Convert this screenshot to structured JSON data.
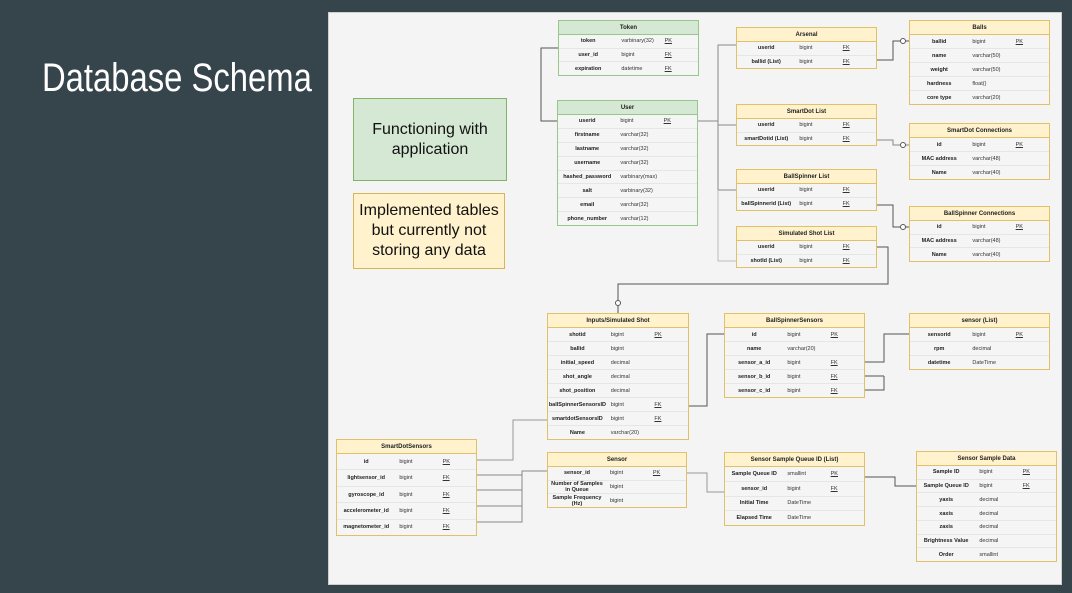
{
  "slide": {
    "title": "Database Schema"
  },
  "legend": {
    "green": "Functioning with application",
    "yellow": "Implemented tables but currently not storing any data"
  },
  "colors": {
    "background": "#36454c",
    "panel": "#f4f4f4",
    "green_fill": "#d5e8d4",
    "green_border": "#82b366",
    "yellow_fill": "#fff2cc",
    "yellow_border": "#d6b656"
  },
  "tables": [
    {
      "name": "Token",
      "status": "functioning",
      "rows": [
        [
          "token",
          "varbinary(32)",
          "PK"
        ],
        [
          "user_id",
          "bigint",
          "FK"
        ],
        [
          "expiration",
          "datetime",
          "FK"
        ]
      ]
    },
    {
      "name": "User",
      "status": "functioning",
      "rows": [
        [
          "userid",
          "bigint",
          "PK"
        ],
        [
          "firstname",
          "varchar(32)",
          ""
        ],
        [
          "lastname",
          "varchar(32)",
          ""
        ],
        [
          "username",
          "varchar(32)",
          ""
        ],
        [
          "hashed_password",
          "varbinary(max)",
          ""
        ],
        [
          "salt",
          "varbinary(32)",
          ""
        ],
        [
          "email",
          "varchar(32)",
          ""
        ],
        [
          "phone_number",
          "varchar(12)",
          ""
        ]
      ]
    },
    {
      "name": "Arsenal",
      "status": "implemented",
      "rows": [
        [
          "userid",
          "bigint",
          "FK"
        ],
        [
          "ballid (List)",
          "bigint",
          "FK"
        ]
      ]
    },
    {
      "name": "SmartDot List",
      "status": "implemented",
      "rows": [
        [
          "userid",
          "bigint",
          "FK"
        ],
        [
          "smartDotid (List)",
          "bigint",
          "FK"
        ]
      ]
    },
    {
      "name": "BallSpinner List",
      "status": "implemented",
      "rows": [
        [
          "userid",
          "bigint",
          "FK"
        ],
        [
          "ballSpinnerid (List)",
          "bigint",
          "FK"
        ]
      ]
    },
    {
      "name": "Simulated Shot List",
      "status": "implemented",
      "rows": [
        [
          "userid",
          "bigint",
          "FK"
        ],
        [
          "shotId (List)",
          "bigint",
          "FK"
        ]
      ]
    },
    {
      "name": "Balls",
      "status": "implemented",
      "rows": [
        [
          "ballid",
          "bigint",
          "PK"
        ],
        [
          "name",
          "varchar(50)",
          ""
        ],
        [
          "weight",
          "varchar(50)",
          ""
        ],
        [
          "hardness",
          "float()",
          ""
        ],
        [
          "core type",
          "varchar(20)",
          ""
        ]
      ]
    },
    {
      "name": "SmartDot Connections",
      "status": "implemented",
      "rows": [
        [
          "id",
          "bigint",
          "PK"
        ],
        [
          "MAC address",
          "varchar(48)",
          ""
        ],
        [
          "Name",
          "varchar(40)",
          ""
        ]
      ]
    },
    {
      "name": "BallSpinner Connections",
      "status": "implemented",
      "rows": [
        [
          "id",
          "bigint",
          "PK"
        ],
        [
          "MAC address",
          "varchar(48)",
          ""
        ],
        [
          "Name",
          "varchar(40)",
          ""
        ]
      ]
    },
    {
      "name": "Inputs/Simulated Shot",
      "status": "implemented",
      "rows": [
        [
          "shotid",
          "bigint",
          "PK"
        ],
        [
          "ballid",
          "bigint",
          ""
        ],
        [
          "initial_speed",
          "decimal",
          ""
        ],
        [
          "shot_angle",
          "decimal",
          ""
        ],
        [
          "shot_position",
          "decimal",
          ""
        ],
        [
          "ballSpinnerSensorsID",
          "bigint",
          "FK"
        ],
        [
          "smartdotSensorsID",
          "bigint",
          "FK"
        ],
        [
          "Name",
          "varchar(20)",
          ""
        ]
      ]
    },
    {
      "name": "BallSpinnerSensors",
      "status": "implemented",
      "rows": [
        [
          "id",
          "bigint",
          "PK"
        ],
        [
          "name",
          "varchar(20)",
          ""
        ],
        [
          "sensor_a_id",
          "bigint",
          "FK"
        ],
        [
          "sensor_b_id",
          "bigint",
          "FK"
        ],
        [
          "sensor_c_id",
          "bigint",
          "FK"
        ]
      ]
    },
    {
      "name": "sensor (List)",
      "status": "implemented",
      "rows": [
        [
          "sensorid",
          "bigint",
          "PK"
        ],
        [
          "rpm",
          "decimal",
          ""
        ],
        [
          "datetime",
          "DateTime",
          ""
        ]
      ]
    },
    {
      "name": "SmartDotSensors",
      "status": "implemented",
      "rows": [
        [
          "id",
          "bigint",
          "PK"
        ],
        [
          "lightsensor_id",
          "bigint",
          "FK"
        ],
        [
          "gyroscope_id",
          "bigint",
          "FK"
        ],
        [
          "accelerometer_id",
          "bigint",
          "FK"
        ],
        [
          "magnetometer_id",
          "bigint",
          "FK"
        ]
      ]
    },
    {
      "name": "Sensor",
      "status": "implemented",
      "rows": [
        [
          "sensor_id",
          "bigint",
          "PK"
        ],
        [
          "Number of Samples in Queue",
          "bigint",
          ""
        ],
        [
          "Sample Frequency (Hz)",
          "bigint",
          ""
        ]
      ]
    },
    {
      "name": "Sensor Sample Queue ID (List)",
      "status": "implemented",
      "rows": [
        [
          "Sample Queue ID",
          "smallint",
          "PK"
        ],
        [
          "sensor_id",
          "bigint",
          "FK"
        ],
        [
          "Initial Time",
          "DateTime",
          ""
        ],
        [
          "Elapsed Time",
          "DateTime",
          ""
        ]
      ]
    },
    {
      "name": "Sensor Sample Data",
      "status": "implemented",
      "rows": [
        [
          "Sample ID",
          "bigint",
          "PK"
        ],
        [
          "Sample Queue ID",
          "bigint",
          "FK"
        ],
        [
          "yaxis",
          "decimal",
          ""
        ],
        [
          "xaxis",
          "decimal",
          ""
        ],
        [
          "zaxis",
          "decimal",
          ""
        ],
        [
          "Brightness Value",
          "decimal",
          ""
        ],
        [
          "Order",
          "smallint",
          ""
        ]
      ]
    }
  ]
}
